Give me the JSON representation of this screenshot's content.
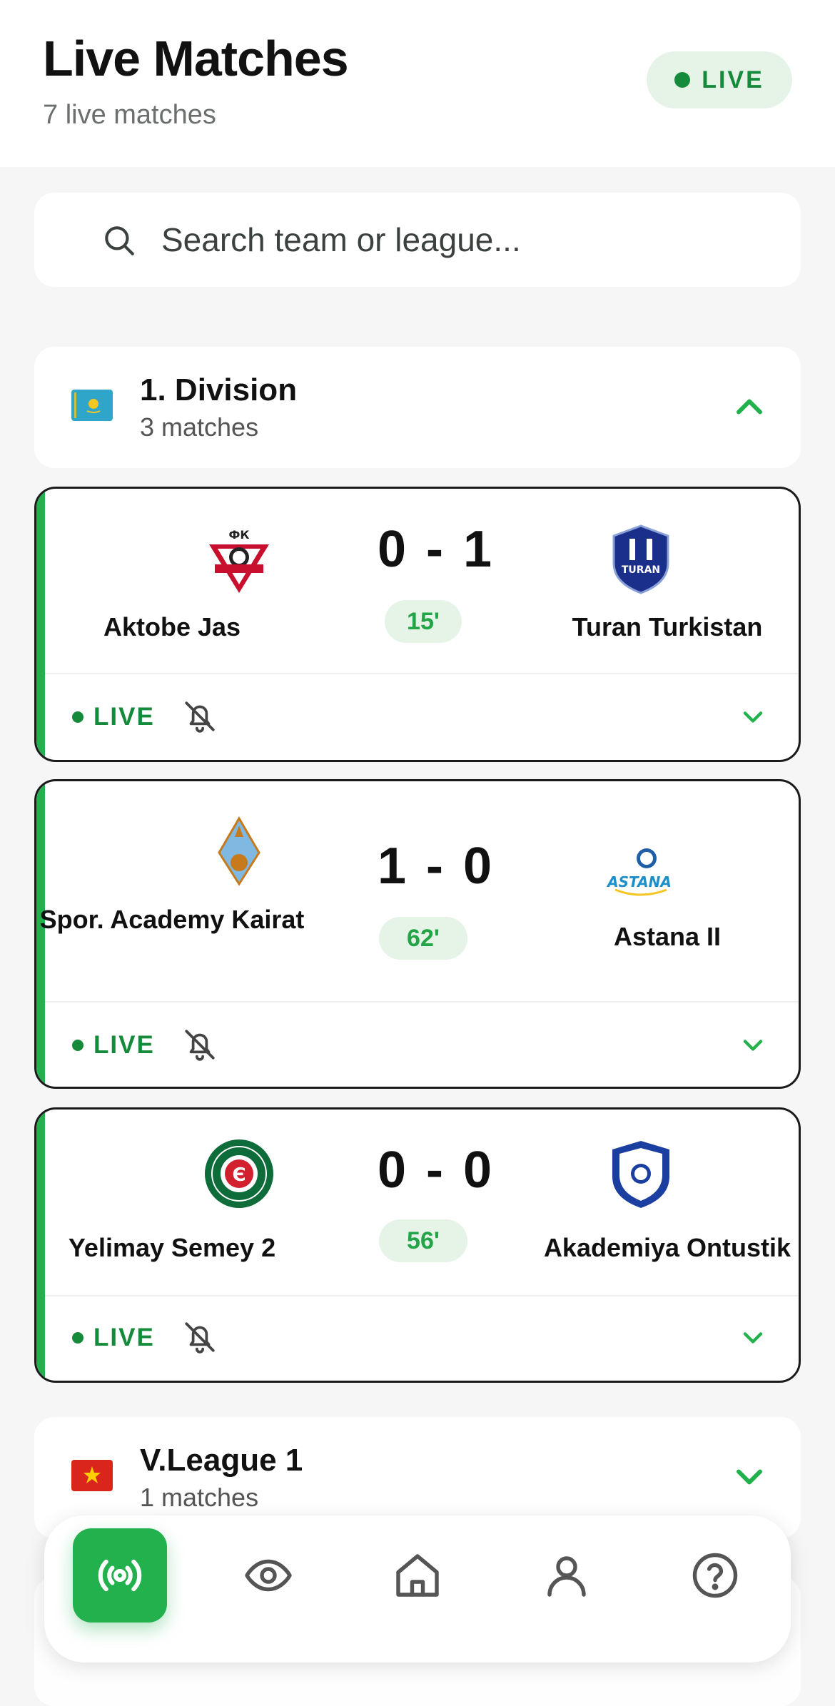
{
  "header": {
    "title": "Live Matches",
    "subtitle": "7 live matches",
    "live_badge": "LIVE"
  },
  "search": {
    "placeholder": "Search team or league..."
  },
  "leagues": [
    {
      "name": "1. Division",
      "count": "3 matches",
      "flag": "kazakhstan-flag",
      "expanded": true,
      "matches": [
        {
          "home": "Aktobe Jas",
          "home_crest": "aktobe-crest",
          "away": "Turan Turkistan",
          "away_crest": "turan-crest",
          "home_score": "0",
          "away_score": "1",
          "score": "0 - 1",
          "minute": "15'",
          "status": "LIVE"
        },
        {
          "home": "Spor. Academy Kairat",
          "home_crest": "kairat-academy-crest",
          "away": "Astana II",
          "away_crest": "astana-crest",
          "home_score": "1",
          "away_score": "0",
          "score": "1 - 0",
          "minute": "62'",
          "status": "LIVE"
        },
        {
          "home": "Yelimay Semey 2",
          "home_crest": "yelimay-crest",
          "away": "Akademiya Ontustik",
          "away_crest": "ontustik-crest",
          "home_score": "0",
          "away_score": "0",
          "score": "0 - 0",
          "minute": "56'",
          "status": "LIVE"
        }
      ]
    },
    {
      "name": "V.League 1",
      "count": "1 matches",
      "flag": "vietnam-flag",
      "expanded": false
    }
  ],
  "nav": {
    "items": [
      "live-icon",
      "eye-icon",
      "home-icon",
      "user-icon",
      "help-icon"
    ],
    "active": "live-icon"
  },
  "colors": {
    "accent": "#22b14c",
    "accent_dark": "#158a3a",
    "accent_soft": "#e6f4e8",
    "background": "#f5f6f5"
  }
}
